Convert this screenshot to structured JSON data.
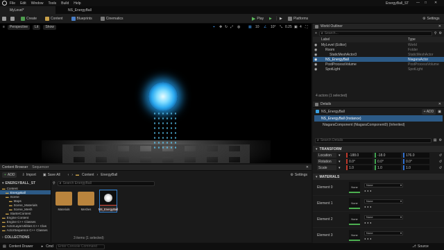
{
  "menu": {
    "items": [
      "File",
      "Edit",
      "Window",
      "Tools",
      "Build",
      "Help"
    ],
    "title": "EnergyBall_ST"
  },
  "tabs": {
    "level": "MyLevel*",
    "asset": "NS_EnergyBall"
  },
  "toolbar": {
    "create": "Create",
    "content": "Content",
    "blueprints": "Blueprints",
    "cinematics": "Cinematics",
    "play": "Play",
    "platforms": "Platforms",
    "settings": "Settings"
  },
  "viewport": {
    "perspective": "Perspective",
    "lit": "Lit",
    "show": "Show",
    "grid": "10",
    "angle": "10°",
    "scale": "0.25",
    "cams": "4"
  },
  "outliner": {
    "title": "World Outliner",
    "search_placeholder": "Search...",
    "col_label": "Label",
    "col_type": "Type",
    "rows": [
      {
        "label": "MyLevel (Editor)",
        "type": "World",
        "indent": 0,
        "selected": false
      },
      {
        "label": "Room",
        "type": "Folder",
        "indent": 1,
        "selected": false
      },
      {
        "label": "StaticMeshActor3",
        "type": "StaticMeshActor",
        "indent": 2,
        "selected": false
      },
      {
        "label": "NS_EnergyBall",
        "type": "NiagaraActor",
        "indent": 1,
        "selected": true
      },
      {
        "label": "PostProcessVolume",
        "type": "PostProcessVolume",
        "indent": 1,
        "selected": false
      },
      {
        "label": "SpotLight",
        "type": "SpotLight",
        "indent": 1,
        "selected": false
      }
    ],
    "status": "4 actors (1 selected)"
  },
  "details": {
    "title": "Details",
    "actor_name": "NS_EnergyBall",
    "add": "+ ADD",
    "instance": "NS_EnergyBall (Instance)",
    "component": "NiagaraComponent (NiagaraComponent0) (Inherited)",
    "search_placeholder": "Search Details",
    "transform": {
      "header": "TRANSFORM",
      "rows": [
        {
          "label": "Location",
          "x": "-188.0",
          "y": "-18.0",
          "z": "176.0"
        },
        {
          "label": "Rotation",
          "x": "0.0°",
          "y": "0.0°",
          "z": "0.0°"
        },
        {
          "label": "Scale",
          "x": "1.0",
          "y": "1.0",
          "z": "1.0"
        }
      ]
    },
    "materials": {
      "header": "MATERIALS",
      "elements": [
        {
          "label": "Element 0",
          "thumb": "None",
          "value": "None"
        },
        {
          "label": "Element 1",
          "thumb": "None",
          "value": "None"
        },
        {
          "label": "Element 2",
          "thumb": "None",
          "value": "None"
        },
        {
          "label": "Element 3",
          "thumb": "None",
          "value": "None"
        }
      ]
    }
  },
  "content_browser": {
    "tab": "Content Browser",
    "tab2": "Sequencer",
    "add": "ADD",
    "import": "Import",
    "save_all": "Save All",
    "path": [
      "Content",
      "EnergyBall"
    ],
    "settings": "Settings",
    "project": "ENERGYBALL_ST",
    "search_placeholder": "Search EnergyBall",
    "tree": [
      {
        "label": "Content",
        "indent": 0,
        "selected": false
      },
      {
        "label": "EnergyBall",
        "indent": 1,
        "selected": true
      },
      {
        "label": "Scene",
        "indent": 1,
        "selected": false
      },
      {
        "label": "Maps",
        "indent": 2,
        "selected": false
      },
      {
        "label": "Scene_Materials",
        "indent": 2,
        "selected": false
      },
      {
        "label": "Scene_Mesh",
        "indent": 2,
        "selected": false
      },
      {
        "label": "StarterContent",
        "indent": 1,
        "selected": false
      },
      {
        "label": "Engine Content",
        "indent": 0,
        "selected": false
      },
      {
        "label": "Engine C++ Classes",
        "indent": 0,
        "selected": false
      },
      {
        "label": "ActorLayerUtilities C++ Clas",
        "indent": 0,
        "selected": false
      },
      {
        "label": "ActorSequence C++ Classes",
        "indent": 0,
        "selected": false
      }
    ],
    "collections": "COLLECTIONS",
    "assets": [
      {
        "label": "Materials",
        "kind": "folder"
      },
      {
        "label": "Meshes",
        "kind": "folder"
      },
      {
        "label": "NS_EnergyBall",
        "kind": "niagara"
      }
    ],
    "status": "3 items (1 selected)"
  },
  "statusbar": {
    "drawer": "Content Drawer",
    "cmd": "Cmd",
    "console_placeholder": "Enter Console Command",
    "source": "Source"
  },
  "colors": {
    "accent": "#2f7fd0",
    "play": "#5cb85c",
    "selection": "#2c5a86",
    "orb": "#36c8ff"
  }
}
